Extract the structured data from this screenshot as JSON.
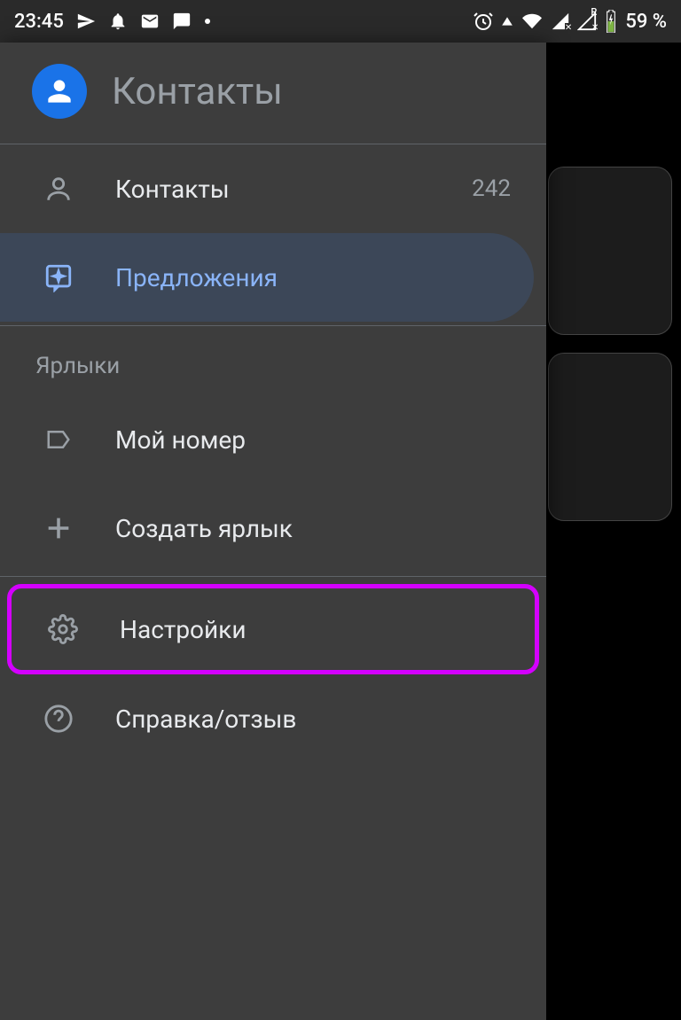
{
  "statusbar": {
    "time": "23:45",
    "battery": "59 %",
    "signal_badge": "R"
  },
  "app": {
    "title": "Контакты"
  },
  "nav": {
    "contacts": {
      "label": "Контакты",
      "count": "242"
    },
    "suggestions": {
      "label": "Предложения"
    }
  },
  "labels_section": {
    "header": "Ярлыки",
    "my_number": "Мой номер",
    "create_label": "Создать ярлык"
  },
  "footer": {
    "settings": "Настройки",
    "help": "Справка/отзыв"
  }
}
